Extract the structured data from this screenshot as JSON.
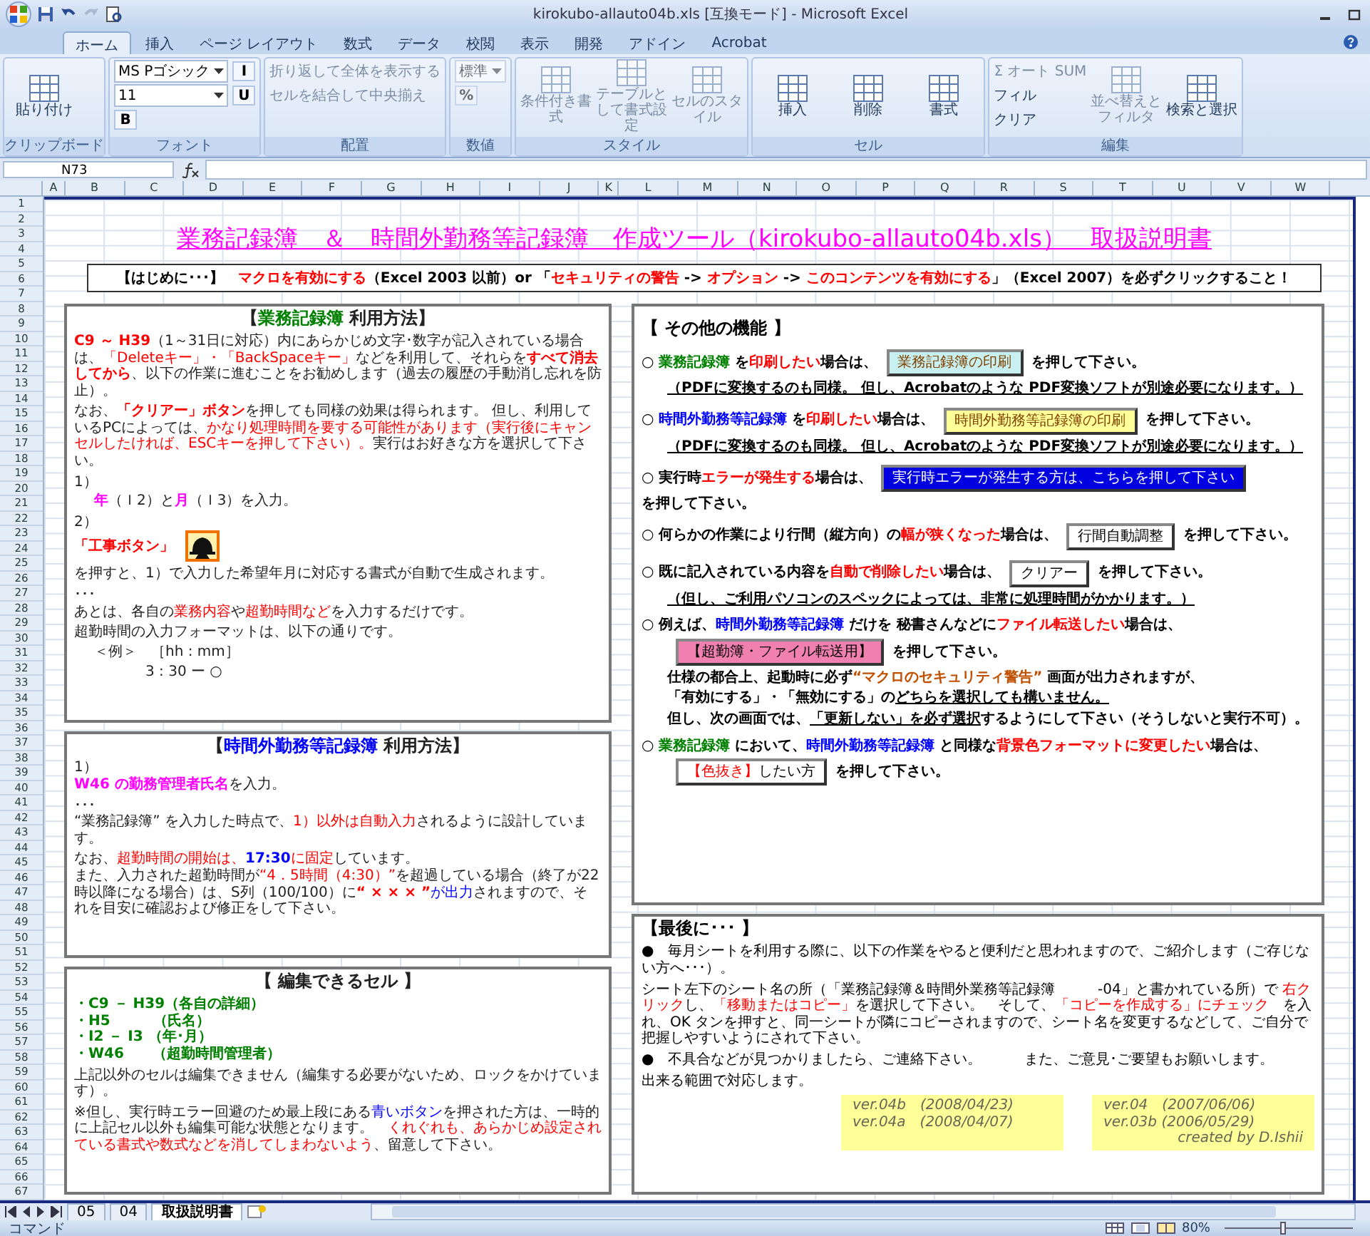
{
  "window": {
    "title": "kirokubo-allauto04b.xls  [互換モード] - Microsoft Excel"
  },
  "ribbon": {
    "tabs": [
      {
        "label": "ホーム",
        "selected": true
      },
      {
        "label": "挿入",
        "selected": false
      },
      {
        "label": "ページ レイアウト",
        "selected": false
      },
      {
        "label": "数式",
        "selected": false
      },
      {
        "label": "データ",
        "selected": false
      },
      {
        "label": "校閲",
        "selected": false
      },
      {
        "label": "表示",
        "selected": false
      },
      {
        "label": "開発",
        "selected": false
      },
      {
        "label": "アドイン",
        "selected": false
      },
      {
        "label": "Acrobat",
        "selected": false
      }
    ],
    "groups": [
      {
        "label": "クリップボード",
        "items": [
          {
            "kind": "large",
            "label": "貼り付け",
            "disabled": false
          }
        ]
      },
      {
        "label": "フォント",
        "items": [
          {
            "kind": "field",
            "label": "MS Pゴシック",
            "disabled": false
          },
          {
            "kind": "field",
            "label": "11",
            "disabled": false
          },
          {
            "kind": "glyph",
            "label": "B",
            "disabled": false
          },
          {
            "kind": "glyph",
            "label": "I",
            "disabled": false
          },
          {
            "kind": "glyph",
            "label": "U",
            "disabled": false
          }
        ]
      },
      {
        "label": "配置",
        "items": [
          {
            "kind": "small",
            "label": "折り返して全体を表示する",
            "disabled": true
          },
          {
            "kind": "small",
            "label": "セルを結合して中央揃え",
            "disabled": true
          }
        ]
      },
      {
        "label": "数値",
        "items": [
          {
            "kind": "field",
            "label": "標準",
            "disabled": true
          },
          {
            "kind": "glyph",
            "label": "%",
            "disabled": true
          }
        ]
      },
      {
        "label": "スタイル",
        "items": [
          {
            "kind": "large",
            "label": "条件付き書式",
            "disabled": true
          },
          {
            "kind": "large",
            "label": "テーブルとして書式設定",
            "disabled": true
          },
          {
            "kind": "large",
            "label": "セルのスタイル",
            "disabled": true
          }
        ]
      },
      {
        "label": "セル",
        "items": [
          {
            "kind": "large",
            "label": "挿入",
            "disabled": false
          },
          {
            "kind": "large",
            "label": "削除",
            "disabled": false
          },
          {
            "kind": "large",
            "label": "書式",
            "disabled": false
          }
        ]
      },
      {
        "label": "編集",
        "items": [
          {
            "kind": "small",
            "label": "Σ オート SUM",
            "disabled": true
          },
          {
            "kind": "small",
            "label": "フィル",
            "disabled": false
          },
          {
            "kind": "small",
            "label": "クリア",
            "disabled": false
          },
          {
            "kind": "large",
            "label": "並べ替えとフィルタ",
            "disabled": true
          },
          {
            "kind": "large",
            "label": "検索と選択",
            "disabled": false
          }
        ]
      }
    ]
  },
  "formula_bar": {
    "name_box": "N73"
  },
  "columns": [
    "A",
    "B",
    "C",
    "D",
    "E",
    "F",
    "G",
    "H",
    "I",
    "J",
    "K",
    "L",
    "M",
    "N",
    "O",
    "P",
    "Q",
    "R",
    "S",
    "T",
    "U",
    "V",
    "W"
  ],
  "rows": [
    "1",
    "2",
    "3",
    "4",
    "5",
    "6",
    "7",
    "8",
    "9",
    "10",
    "11",
    "12",
    "13",
    "14",
    "15",
    "16",
    "17",
    "18",
    "19",
    "20",
    "21",
    "22",
    "23",
    "24",
    "25",
    "26",
    "27",
    "28",
    "29",
    "30",
    "31",
    "32",
    "33",
    "34",
    "35",
    "36",
    "37",
    "38",
    "39",
    "40",
    "41",
    "42",
    "43",
    "44",
    "45",
    "46",
    "47",
    "48",
    "49",
    "50",
    "51",
    "52",
    "53",
    "54",
    "55",
    "56",
    "57",
    "58",
    "59",
    "60",
    "61",
    "62",
    "63",
    "64",
    "65",
    "66",
    "67"
  ],
  "sheet": {
    "title": "業務記録簿　＆　時間外勤務等記録簿　作成ツール（kirokubo-allauto04b.xls）　取扱説明書",
    "notice": [
      "【はじめに･･･】　",
      {
        "text": "マクロを有効にする",
        "color": "#ff0000"
      },
      "（Excel 2003 以前）or 「",
      {
        "text": "セキュリティの警告",
        "color": "#ff0000"
      },
      " -> ",
      {
        "text": "オプション",
        "color": "#ff0000"
      },
      " -> ",
      {
        "text": "このコンテンツを有効にする",
        "color": "#ff0000"
      },
      "」（Excel 2007）を必ずクリックすること！"
    ],
    "left_panels": [
      {
        "kind": "notes",
        "paragraphs": [
          {
            "kind": "heading",
            "segments": [
              "【",
              {
                "text": "業務記録簿",
                "color": "#008000"
              },
              " 利用方法】"
            ]
          },
          {
            "kind": "line",
            "segments": [
              {
                "text": "**C9 ～ H39**",
                "color": "#ff0000"
              },
              "（1～31日に対応）内にあらかじめ文字･数字が記入されている場合は、",
              {
                "text": "「Deleteキー」・「BackSpaceキー」",
                "color": "#ff0000"
              },
              "などを利用して、それらを",
              {
                "text": "**すべて消去してから**",
                "color": "#ff0000"
              },
              "、以下の作業に進むことをお勧めします（過去の履歴の手動消し忘れを防止）。"
            ]
          },
          {
            "kind": "line",
            "segments": [
              "なお、",
              {
                "text": "**「クリアー」ボタン**",
                "color": "#ff0000"
              },
              "を押しても同様の効果は得られます。 但し、利用しているPCによっては、",
              {
                "text": "かなり処理時間を要する可能性があります（実行後にキャンセルしたければ、ESCキーを押して下さい）。",
                "color": "#ff0000"
              },
              "実行はお好きな方を選択して下さい。"
            ]
          },
          {
            "kind": "line",
            "segments": [
              "1）"
            ]
          },
          {
            "kind": "indent",
            "segments": [
              {
                "text": "**年**",
                "color": "#ff00ff"
              },
              "（Ｉ2）と",
              {
                "text": "**月**",
                "color": "#ff00ff"
              },
              "（Ｉ3）を入力。"
            ]
          },
          {
            "kind": "line",
            "segments": [
              "2）"
            ]
          },
          {
            "kind": "tight",
            "segments": [
              {
                "text": "**「工事ボタン」**",
                "color": "#ff0000"
              },
              {
                "kind": "icon"
              },
              "を押すと、1）で入力した希望年月に対応する書式が自動で生成されます。"
            ]
          },
          {
            "kind": "line",
            "segments": [
              "･･･"
            ]
          },
          {
            "kind": "tight",
            "segments": [
              "あとは、各自の",
              {
                "text": "業務内容",
                "color": "#ff0000"
              },
              "や",
              {
                "text": "超勤時間など",
                "color": "#ff0000"
              },
              "を入力するだけです。"
            ]
          },
          {
            "kind": "line",
            "segments": [
              "超勤時間の入力フォーマットは、以下の通りです。"
            ]
          },
          {
            "kind": "indent",
            "segments": [
              "＜例＞　［hh : mm］"
            ]
          },
          {
            "kind": "deep",
            "segments": [
              "3 : 30 ー ○"
            ]
          }
        ]
      },
      {
        "kind": "notes",
        "paragraphs": [
          {
            "kind": "heading",
            "segments": [
              "【",
              {
                "text": "時間外勤務等記録簿",
                "color": "#0000ff"
              },
              " 利用方法】"
            ]
          },
          {
            "kind": "line",
            "segments": [
              "1）"
            ]
          },
          {
            "kind": "tight",
            "segments": [
              {
                "text": "**W46 の勤務管理者氏名**",
                "color": "#ff00ff"
              },
              "を入力。"
            ]
          },
          {
            "kind": "line",
            "segments": [
              "･･･"
            ]
          },
          {
            "kind": "tight",
            "segments": [
              "“業務記録簿” を入力した時点で、",
              {
                "text": "1）以外は自動入力",
                "color": "#ff0000"
              },
              "されるように設計しています。"
            ]
          },
          {
            "kind": "line",
            "segments": [
              "なお、",
              {
                "text": "超勤時間の開始は、",
                "color": "#ff0000"
              },
              {
                "text": "**17:30**",
                "color": "#0000ff"
              },
              {
                "text": "に固定",
                "color": "#ff0000"
              },
              "しています。"
            ]
          },
          {
            "kind": "tight",
            "segments": [
              "また、入力された超勤時間が",
              {
                "text": "“4．5時間（4:30）”",
                "color": "#ff0000"
              },
              "を超過している場合（終了が22時以降になる場合）は、S列（100/100）に",
              {
                "text": "**“ × × × ”**",
                "color": "#ff0000"
              },
              {
                "text": "が出力",
                "color": "#0000ff"
              },
              "されますので、それを目安に確認および修正をして下さい。"
            ]
          }
        ]
      },
      {
        "kind": "notes",
        "paragraphs": [
          {
            "kind": "heading",
            "segments": [
              "【 編集できるセル 】"
            ]
          },
          {
            "kind": "line",
            "segments": [
              {
                "text": "**・C9 － H39（各自の詳細）**",
                "color": "#008000"
              }
            ]
          },
          {
            "kind": "tight",
            "segments": [
              {
                "text": "**・H5　　　（氏名）**",
                "color": "#008000"
              }
            ]
          },
          {
            "kind": "tight",
            "segments": [
              {
                "text": "**・I2 － I3 （年･月）**",
                "color": "#008000"
              }
            ]
          },
          {
            "kind": "tight",
            "segments": [
              {
                "text": "**・W46　　（超勤時間管理者）**",
                "color": "#008000"
              }
            ]
          },
          {
            "kind": "line",
            "segments": [
              "上記以外のセルは編集できません（編集する必要がないため、ロックをかけています）。"
            ]
          },
          {
            "kind": "line",
            "segments": [
              "※但し、実行時エラー回避のため最上段にある",
              {
                "text": "青いボタン",
                "color": "#0000ff"
              },
              "を押された方は、一時的に上記セル以外も編集可能な状態となります。　",
              {
                "text": "くれぐれも、あらかじめ設定されている書式や数式などを消してしまわないよう",
                "color": "#ff0000"
              },
              "、留意して下さい。"
            ]
          }
        ]
      }
    ],
    "right_panels": [
      {
        "kind": "features",
        "paragraphs": [
          {
            "kind": "heading",
            "segments": [
              "【 その他の機能 】"
            ]
          },
          {
            "kind": "line",
            "segments": [
              "○ ",
              {
                "text": "業務記録簿",
                "color": "#008000"
              },
              " を",
              {
                "text": "印刷したい",
                "color": "#ff0000"
              },
              "場合は、",
              {
                "kind": "button",
                "color": "#c8f0f0",
                "segments": [
                  {
                    "text": "業務記録簿の印刷",
                    "color": "#804000"
                  }
                ]
              },
              "を押して下さい。"
            ]
          },
          {
            "kind": "indent",
            "segments": [
              {
                "kind": "underlined",
                "text": "（PDFに変換するのも同様。 但し、Acrobatのような PDF変換ソフトが別途必要になります。）"
              }
            ]
          },
          {
            "kind": "line",
            "segments": [
              "○ ",
              {
                "text": "時間外勤務等記録簿",
                "color": "#0000ff"
              },
              " を",
              {
                "text": "印刷したい",
                "color": "#ff0000"
              },
              "場合は、",
              {
                "kind": "button",
                "color": "#ffff99",
                "segments": [
                  {
                    "text": "時間外勤務等記録簿の印刷",
                    "color": "#804000"
                  }
                ]
              },
              "を押して下さい。"
            ]
          },
          {
            "kind": "indent",
            "segments": [
              {
                "kind": "underlined",
                "text": "（PDFに変換するのも同様。 但し、Acrobatのような PDF変換ソフトが別途必要になります。）"
              }
            ]
          },
          {
            "kind": "line",
            "segments": [
              "○ 実行時",
              {
                "text": "エラーが発生する",
                "color": "#ff0000"
              },
              "場合は、",
              {
                "kind": "button",
                "color": "#0000e0",
                "segments": [
                  {
                    "text": "実行時エラーが発生する方は、こちらを押して下さい",
                    "color": "#ffffff"
                  }
                ]
              },
              "を押して下さい。"
            ]
          },
          {
            "kind": "line",
            "segments": [
              "○ 何らかの作業により行間（縦方向）の",
              {
                "text": "幅が狭くなった",
                "color": "#ff0000"
              },
              "場合は、",
              {
                "kind": "button",
                "color": "#ffffff",
                "segments": [
                  "行間自動調整"
                ]
              },
              "を押して下さい。"
            ]
          },
          {
            "kind": "line",
            "segments": [
              "○ 既に記入されている内容を",
              {
                "text": "自動で削除したい",
                "color": "#ff0000"
              },
              "場合は、",
              {
                "kind": "button",
                "color": "#ffffff",
                "segments": [
                  "クリアー"
                ]
              },
              "を押して下さい。"
            ]
          },
          {
            "kind": "indent",
            "segments": [
              {
                "kind": "underlined",
                "text": "（但し、ご利用パソコンのスペックによっては、非常に処理時間がかかります。）"
              }
            ]
          },
          {
            "kind": "line",
            "segments": [
              "○ 例えば、",
              {
                "text": "時間外勤務等記録簿",
                "color": "#0000ff"
              },
              " だけを 秘書さんなどに",
              {
                "text": "ファイル転送したい",
                "color": "#ff0000"
              },
              "場合は、"
            ]
          },
          {
            "kind": "indent",
            "segments": [
              {
                "kind": "button",
                "color": "#f080b0",
                "segments": [
                  "【超勤簿・ファイル転送用】"
                ]
              },
              "を押して下さい。"
            ]
          },
          {
            "kind": "indent",
            "segments": [
              "仕様の都合上、起動時に必ず",
              {
                "text": "“マクロのセキュリティ警告”",
                "color": "#c05000"
              },
              " 画面が出力されますが、"
            ]
          },
          {
            "kind": "indent",
            "segments": [
              "「有効にする」・「無効にする」の",
              {
                "kind": "underlined",
                "text": "どちらを選択しても構いません。"
              }
            ]
          },
          {
            "kind": "indent",
            "segments": [
              "但し、次の画面では、",
              {
                "kind": "underlined",
                "text": "「更新しない」を必ず選択"
              },
              "するようにして下さい（そうしないと実行不可）。"
            ]
          },
          {
            "kind": "line",
            "segments": [
              "○ ",
              {
                "text": "業務記録簿",
                "color": "#008000"
              },
              " において、",
              {
                "text": "時間外勤務等記録簿",
                "color": "#0000ff"
              },
              " と同様な",
              {
                "text": "背景色フォーマットに変更したい",
                "color": "#ff0000"
              },
              "場合は、"
            ]
          },
          {
            "kind": "indent",
            "segments": [
              {
                "kind": "button",
                "color": "#ffffff",
                "segments": [
                  {
                    "text": "【色抜き】",
                    "color": "#ff0000"
                  },
                  "したい方"
                ]
              },
              "を押して下さい。"
            ]
          }
        ]
      },
      {
        "kind": "closing",
        "paragraphs": [
          {
            "kind": "heading",
            "segments": [
              "【最後に･･･ 】"
            ]
          },
          {
            "kind": "line",
            "segments": [
              "●　毎月シートを利用する際に、以下の作業をやると便利だと思われますので、ご紹介します（ご存じない方へ･･･）。"
            ]
          },
          {
            "kind": "line",
            "segments": [
              "シート左下のシート名の所（「業務記録簿＆時間外業務等記録簿　　　-04」と書かれている所）で ",
              {
                "text": "右クリック",
                "color": "#ff0000"
              },
              "し、",
              {
                "text": "「移動またはコピー」",
                "color": "#ff0000"
              },
              "を選択して下さい。　そして、",
              {
                "text": "「コピーを作成する」にチェック",
                "color": "#ff0000"
              },
              "　を入れ、OK タンを押すと、同一シートが隣にコピーされますので、シート名を変更するなどして、ご自分で把握しやすいようにされて下さい。"
            ]
          },
          {
            "kind": "spread",
            "segments": [
              "●　不具合などが見つかりましたら、ご連絡下さい。",
              "また、ご意見･ご要望もお願いします。",
              "出来る範囲で対応します。"
            ]
          }
        ],
        "versions": [
          {
            "lines": [
              "ver.04b　(2008/04/23)",
              "ver.04a　(2008/04/07)"
            ]
          },
          {
            "lines": [
              "ver.04　(2007/06/06)",
              "ver.03b (2006/05/29)",
              "created by  D.Ishii"
            ]
          }
        ]
      }
    ]
  },
  "sheet_tabs": [
    {
      "label": "05",
      "selected": false
    },
    {
      "label": "04",
      "selected": false
    },
    {
      "label": "取扱説明書",
      "selected": true
    }
  ],
  "status_bar": {
    "mode": "コマンド",
    "zoom": "80%",
    "zoom_slider": {
      "level": 0.45
    }
  }
}
